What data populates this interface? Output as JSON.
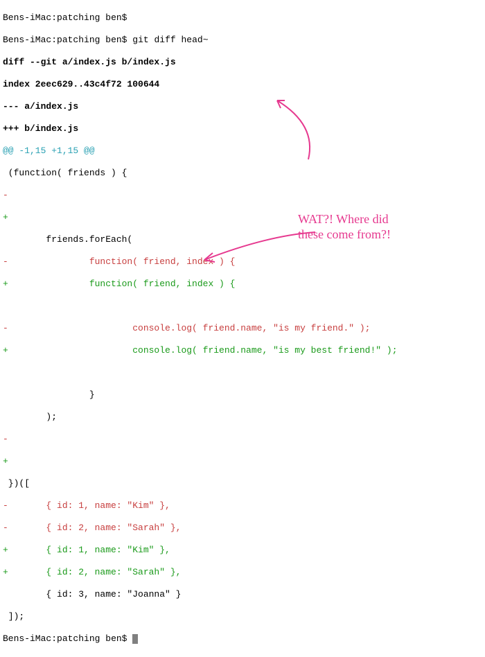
{
  "prompt": {
    "host": "Bens-iMac",
    "dir": "patching",
    "user": "ben",
    "symbol": "$"
  },
  "commands": {
    "line1": "",
    "line2": "git diff head~"
  },
  "diff": {
    "header1": "diff --git a/index.js b/index.js",
    "header2": "index 2eec629..43c4f72 100644",
    "header3": "--- a/index.js",
    "header4": "+++ b/index.js",
    "hunk": "@@ -1,15 +1,15 @@",
    "ctx1": " (function( friends ) {",
    "rem1": "-",
    "add1": "+",
    "ctx2": "        friends.forEach(",
    "rem2": "-               function( friend, index ) {",
    "add2": "+               function( friend, index ) {",
    "blank1": " ",
    "rem3": "-                       console.log( friend.name, \"is my friend.\" );",
    "add3": "+                       console.log( friend.name, \"is my best friend!\" );",
    "blank2": " ",
    "ctx3": "                }",
    "ctx4": "        );",
    "rem4": "-",
    "add4": "+",
    "ctx5": " })([",
    "rem5": "-       { id: 1, name: \"Kim\" },",
    "rem6": "-       { id: 2, name: \"Sarah\" },",
    "add5": "+       { id: 1, name: \"Kim\" },",
    "add6": "+       { id: 2, name: \"Sarah\" },",
    "ctx6": "        { id: 3, name: \"Joanna\" }",
    "ctx7": " ]);"
  },
  "annotations": {
    "text1": "WAT?! Where did",
    "text2": "these come from?!"
  }
}
